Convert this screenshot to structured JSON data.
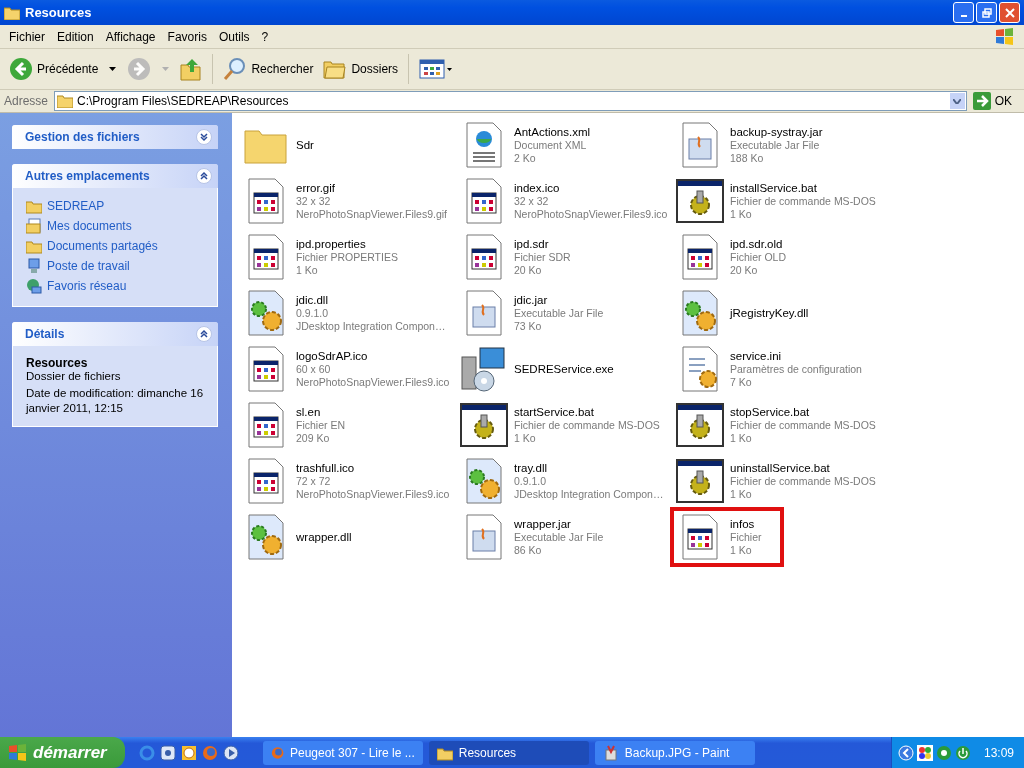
{
  "window": {
    "title": "Resources"
  },
  "menu": [
    "Fichier",
    "Edition",
    "Affichage",
    "Favoris",
    "Outils",
    "?"
  ],
  "toolbar": {
    "back": "Précédente",
    "search": "Rechercher",
    "folders": "Dossiers",
    "forward_disabled": true
  },
  "address": {
    "label": "Adresse",
    "value": "C:\\Program Files\\SEDREAP\\Resources",
    "go": "OK"
  },
  "sidebar": [
    {
      "title": "Gestion des fichiers",
      "expanded": false
    },
    {
      "title": "Autres emplacements",
      "expanded": true,
      "items": [
        {
          "label": "SEDREAP"
        },
        {
          "label": "Mes documents"
        },
        {
          "label": "Documents partagés"
        },
        {
          "label": "Poste de travail"
        },
        {
          "label": "Favoris réseau"
        }
      ]
    },
    {
      "title": "Détails",
      "expanded": true,
      "name": "Resources",
      "type": "Dossier de fichiers",
      "modified": "Date de modification: dimanche 16 janvier 2011, 12:15"
    }
  ],
  "files": [
    {
      "kind": "folder",
      "name": "Sdr",
      "highlighted": false
    },
    {
      "kind": "xml",
      "name": "AntActions.xml",
      "lines": [
        "Document XML",
        "2 Ko"
      ],
      "highlighted": false
    },
    {
      "kind": "jar",
      "name": "backup-systray.jar",
      "lines": [
        "Executable Jar File",
        "188 Ko"
      ],
      "highlighted": false
    },
    {
      "kind": "image",
      "name": "error.gif",
      "lines": [
        "32 x 32",
        "NeroPhotoSnapViewer.Files9.gif"
      ],
      "highlighted": false
    },
    {
      "kind": "image",
      "name": "index.ico",
      "lines": [
        "32 x 32",
        "NeroPhotoSnapViewer.Files9.ico"
      ],
      "highlighted": false
    },
    {
      "kind": "bat",
      "name": "installService.bat",
      "lines": [
        "Fichier de commande MS-DOS",
        "1 Ko"
      ],
      "highlighted": false
    },
    {
      "kind": "image",
      "name": "ipd.properties",
      "lines": [
        "Fichier PROPERTIES",
        "1 Ko"
      ],
      "highlighted": false
    },
    {
      "kind": "image",
      "name": "ipd.sdr",
      "lines": [
        "Fichier SDR",
        "20 Ko"
      ],
      "highlighted": false
    },
    {
      "kind": "image",
      "name": "ipd.sdr.old",
      "lines": [
        "Fichier OLD",
        "20 Ko"
      ],
      "highlighted": false
    },
    {
      "kind": "dll",
      "name": "jdic.dll",
      "lines": [
        "0.9.1.0",
        "JDesktop Integration Compon…"
      ],
      "highlighted": false
    },
    {
      "kind": "jar",
      "name": "jdic.jar",
      "lines": [
        "Executable Jar File",
        "73 Ko"
      ],
      "highlighted": false
    },
    {
      "kind": "dll",
      "name": "jRegistryKey.dll",
      "highlighted": false
    },
    {
      "kind": "image",
      "name": "logoSdrAP.ico",
      "lines": [
        "60 x 60",
        "NeroPhotoSnapViewer.Files9.ico"
      ],
      "highlighted": false
    },
    {
      "kind": "exe",
      "name": "SEDREService.exe",
      "highlighted": false
    },
    {
      "kind": "ini",
      "name": "service.ini",
      "lines": [
        "Paramètres de configuration",
        "7 Ko"
      ],
      "highlighted": false
    },
    {
      "kind": "image",
      "name": "sl.en",
      "lines": [
        "Fichier EN",
        "209 Ko"
      ],
      "highlighted": false
    },
    {
      "kind": "bat",
      "name": "startService.bat",
      "lines": [
        "Fichier de commande MS-DOS",
        "1 Ko"
      ],
      "highlighted": false
    },
    {
      "kind": "bat",
      "name": "stopService.bat",
      "lines": [
        "Fichier de commande MS-DOS",
        "1 Ko"
      ],
      "highlighted": false
    },
    {
      "kind": "image",
      "name": "trashfull.ico",
      "lines": [
        "72 x 72",
        "NeroPhotoSnapViewer.Files9.ico"
      ],
      "highlighted": false
    },
    {
      "kind": "dll",
      "name": "tray.dll",
      "lines": [
        "0.9.1.0",
        "JDesktop Integration Compon…"
      ],
      "highlighted": false
    },
    {
      "kind": "bat",
      "name": "uninstallService.bat",
      "lines": [
        "Fichier de commande MS-DOS",
        "1 Ko"
      ],
      "highlighted": false
    },
    {
      "kind": "dll",
      "name": "wrapper.dll",
      "highlighted": false
    },
    {
      "kind": "jar",
      "name": "wrapper.jar",
      "lines": [
        "Executable Jar File",
        "86 Ko"
      ],
      "highlighted": false
    },
    {
      "kind": "image",
      "name": "infos",
      "lines": [
        "Fichier",
        "1 Ko"
      ],
      "highlighted": true
    }
  ],
  "taskbar": {
    "start": "démarrer",
    "tasks": [
      {
        "label": "Peugeot 307 - Lire le ...",
        "selected": false
      },
      {
        "label": "Resources",
        "selected": true
      },
      {
        "label": "Backup.JPG - Paint",
        "selected": false
      }
    ],
    "clock": "13:09"
  }
}
